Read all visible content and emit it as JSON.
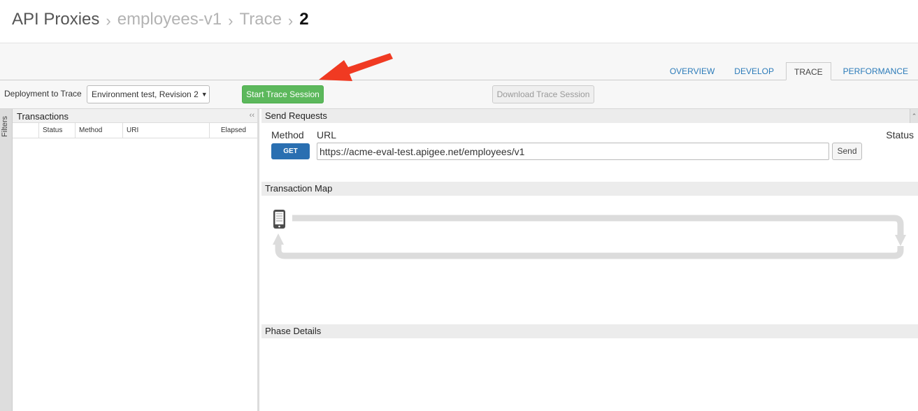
{
  "breadcrumb": {
    "root": "API Proxies",
    "proxy": "employees-v1",
    "section": "Trace",
    "current": "2",
    "separator": "›"
  },
  "tabs": [
    {
      "label": "OVERVIEW",
      "active": false
    },
    {
      "label": "DEVELOP",
      "active": false
    },
    {
      "label": "TRACE",
      "active": true
    },
    {
      "label": "PERFORMANCE",
      "active": false
    }
  ],
  "toolbar": {
    "deploy_label": "Deployment to Trace",
    "deploy_value": "Environment test, Revision 2",
    "start_label": "Start Trace Session",
    "download_label": "Download Trace Session"
  },
  "filters": {
    "label": "Filters"
  },
  "transactions": {
    "title": "Transactions",
    "columns": [
      "",
      "Status",
      "Method",
      "URI",
      "Elapsed"
    ]
  },
  "send_requests": {
    "title": "Send Requests",
    "method_label": "Method",
    "url_label": "URL",
    "status_label": "Status",
    "method_value": "GET",
    "url_value": "https://acme-eval-test.apigee.net/employees/v1",
    "send_label": "Send"
  },
  "transaction_map": {
    "title": "Transaction Map"
  },
  "phase_details": {
    "title": "Phase Details"
  },
  "colors": {
    "start_button": "#5cb85c",
    "get_button": "#2a6fb1",
    "tab_link": "#2b7bb9",
    "annotation_arrow": "#f03a22"
  },
  "icons": {
    "collapse": "double-chevron-left-icon",
    "expand": "double-chevron-up-icon",
    "client": "mobile-device-icon",
    "annotation": "red-arrow"
  }
}
